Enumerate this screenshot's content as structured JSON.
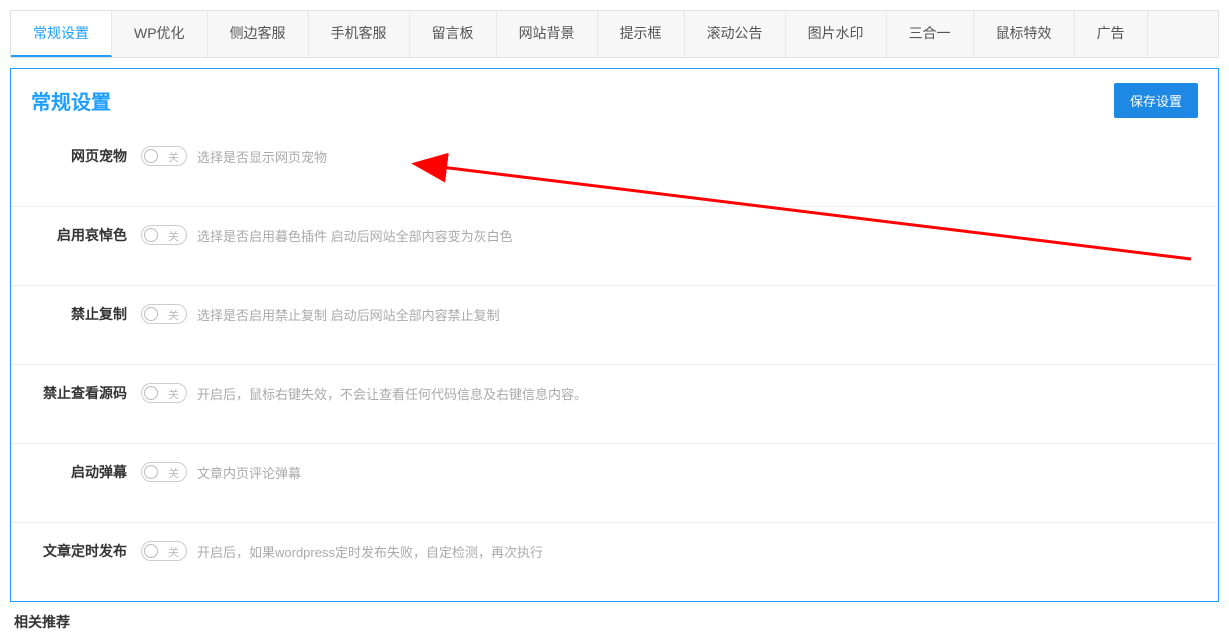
{
  "tabs": [
    {
      "label": "常规设置",
      "active": true
    },
    {
      "label": "WP优化"
    },
    {
      "label": "侧边客服"
    },
    {
      "label": "手机客服"
    },
    {
      "label": "留言板"
    },
    {
      "label": "网站背景"
    },
    {
      "label": "提示框"
    },
    {
      "label": "滚动公告"
    },
    {
      "label": "图片水印"
    },
    {
      "label": "三合一"
    },
    {
      "label": "鼠标特效"
    },
    {
      "label": "广告"
    }
  ],
  "panel": {
    "title": "常规设置",
    "save_label": "保存设置"
  },
  "switch_off_text": "关",
  "rows": [
    {
      "label": "网页宠物",
      "desc": "选择是否显示网页宠物"
    },
    {
      "label": "启用哀悼色",
      "desc": "选择是否启用暮色插件 启动后网站全部内容变为灰白色"
    },
    {
      "label": "禁止复制",
      "desc": "选择是否启用禁止复制 启动后网站全部内容禁止复制"
    },
    {
      "label": "禁止查看源码",
      "desc": "开启后，鼠标右键失效，不会让查看任何代码信息及右键信息内容。"
    },
    {
      "label": "启动弹幕",
      "desc": "文章内页评论弹幕"
    },
    {
      "label": "文章定时发布",
      "desc": "开启后，如果wordpress定时发布失败，自定检测，再次执行"
    }
  ],
  "footer": "相关推荐"
}
